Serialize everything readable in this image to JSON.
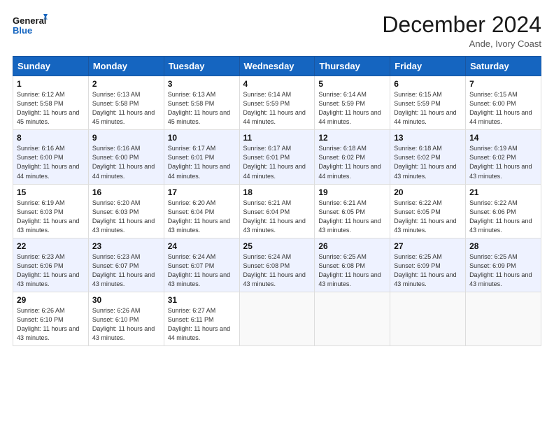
{
  "logo": {
    "line1": "General",
    "line2": "Blue"
  },
  "title": "December 2024",
  "subtitle": "Ande, Ivory Coast",
  "days_of_week": [
    "Sunday",
    "Monday",
    "Tuesday",
    "Wednesday",
    "Thursday",
    "Friday",
    "Saturday"
  ],
  "weeks": [
    [
      {
        "day": "1",
        "sunrise": "6:12 AM",
        "sunset": "5:58 PM",
        "daylight": "11 hours and 45 minutes."
      },
      {
        "day": "2",
        "sunrise": "6:13 AM",
        "sunset": "5:58 PM",
        "daylight": "11 hours and 45 minutes."
      },
      {
        "day": "3",
        "sunrise": "6:13 AM",
        "sunset": "5:58 PM",
        "daylight": "11 hours and 45 minutes."
      },
      {
        "day": "4",
        "sunrise": "6:14 AM",
        "sunset": "5:59 PM",
        "daylight": "11 hours and 44 minutes."
      },
      {
        "day": "5",
        "sunrise": "6:14 AM",
        "sunset": "5:59 PM",
        "daylight": "11 hours and 44 minutes."
      },
      {
        "day": "6",
        "sunrise": "6:15 AM",
        "sunset": "5:59 PM",
        "daylight": "11 hours and 44 minutes."
      },
      {
        "day": "7",
        "sunrise": "6:15 AM",
        "sunset": "6:00 PM",
        "daylight": "11 hours and 44 minutes."
      }
    ],
    [
      {
        "day": "8",
        "sunrise": "6:16 AM",
        "sunset": "6:00 PM",
        "daylight": "11 hours and 44 minutes."
      },
      {
        "day": "9",
        "sunrise": "6:16 AM",
        "sunset": "6:00 PM",
        "daylight": "11 hours and 44 minutes."
      },
      {
        "day": "10",
        "sunrise": "6:17 AM",
        "sunset": "6:01 PM",
        "daylight": "11 hours and 44 minutes."
      },
      {
        "day": "11",
        "sunrise": "6:17 AM",
        "sunset": "6:01 PM",
        "daylight": "11 hours and 44 minutes."
      },
      {
        "day": "12",
        "sunrise": "6:18 AM",
        "sunset": "6:02 PM",
        "daylight": "11 hours and 44 minutes."
      },
      {
        "day": "13",
        "sunrise": "6:18 AM",
        "sunset": "6:02 PM",
        "daylight": "11 hours and 43 minutes."
      },
      {
        "day": "14",
        "sunrise": "6:19 AM",
        "sunset": "6:02 PM",
        "daylight": "11 hours and 43 minutes."
      }
    ],
    [
      {
        "day": "15",
        "sunrise": "6:19 AM",
        "sunset": "6:03 PM",
        "daylight": "11 hours and 43 minutes."
      },
      {
        "day": "16",
        "sunrise": "6:20 AM",
        "sunset": "6:03 PM",
        "daylight": "11 hours and 43 minutes."
      },
      {
        "day": "17",
        "sunrise": "6:20 AM",
        "sunset": "6:04 PM",
        "daylight": "11 hours and 43 minutes."
      },
      {
        "day": "18",
        "sunrise": "6:21 AM",
        "sunset": "6:04 PM",
        "daylight": "11 hours and 43 minutes."
      },
      {
        "day": "19",
        "sunrise": "6:21 AM",
        "sunset": "6:05 PM",
        "daylight": "11 hours and 43 minutes."
      },
      {
        "day": "20",
        "sunrise": "6:22 AM",
        "sunset": "6:05 PM",
        "daylight": "11 hours and 43 minutes."
      },
      {
        "day": "21",
        "sunrise": "6:22 AM",
        "sunset": "6:06 PM",
        "daylight": "11 hours and 43 minutes."
      }
    ],
    [
      {
        "day": "22",
        "sunrise": "6:23 AM",
        "sunset": "6:06 PM",
        "daylight": "11 hours and 43 minutes."
      },
      {
        "day": "23",
        "sunrise": "6:23 AM",
        "sunset": "6:07 PM",
        "daylight": "11 hours and 43 minutes."
      },
      {
        "day": "24",
        "sunrise": "6:24 AM",
        "sunset": "6:07 PM",
        "daylight": "11 hours and 43 minutes."
      },
      {
        "day": "25",
        "sunrise": "6:24 AM",
        "sunset": "6:08 PM",
        "daylight": "11 hours and 43 minutes."
      },
      {
        "day": "26",
        "sunrise": "6:25 AM",
        "sunset": "6:08 PM",
        "daylight": "11 hours and 43 minutes."
      },
      {
        "day": "27",
        "sunrise": "6:25 AM",
        "sunset": "6:09 PM",
        "daylight": "11 hours and 43 minutes."
      },
      {
        "day": "28",
        "sunrise": "6:25 AM",
        "sunset": "6:09 PM",
        "daylight": "11 hours and 43 minutes."
      }
    ],
    [
      {
        "day": "29",
        "sunrise": "6:26 AM",
        "sunset": "6:10 PM",
        "daylight": "11 hours and 43 minutes."
      },
      {
        "day": "30",
        "sunrise": "6:26 AM",
        "sunset": "6:10 PM",
        "daylight": "11 hours and 43 minutes."
      },
      {
        "day": "31",
        "sunrise": "6:27 AM",
        "sunset": "6:11 PM",
        "daylight": "11 hours and 44 minutes."
      },
      null,
      null,
      null,
      null
    ]
  ]
}
